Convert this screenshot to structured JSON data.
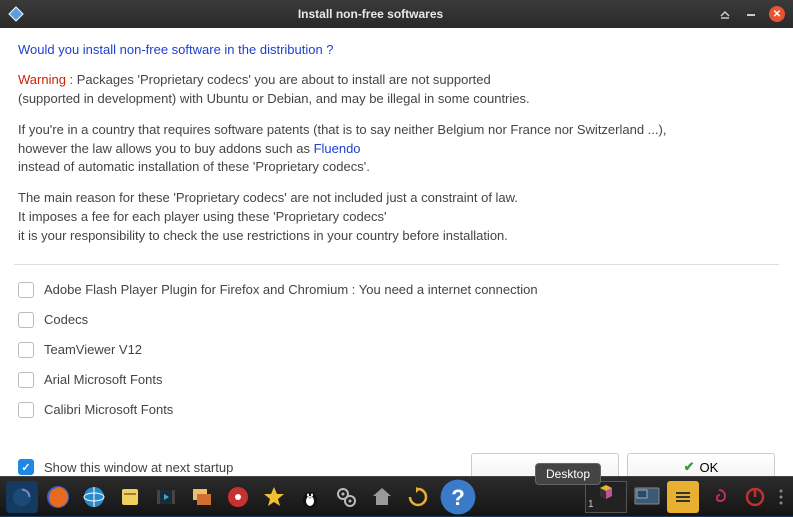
{
  "titlebar": {
    "title": "Install non-free softwares"
  },
  "content": {
    "question": "Would you install non-free software in the distribution ?",
    "warning_label": "Warning : ",
    "warning_line1": "Packages 'Proprietary codecs' you are about to install are not supported",
    "warning_line2": "(supported in development) with Ubuntu or Debian, and may be illegal in some countries.",
    "patents_line1a": "If you're in a country that requires software patents (that is to say neither Belgium nor France nor Switzerland ...),",
    "patents_line2a": "however the law allows you to buy addons such as ",
    "fluendo_link": "Fluendo",
    "patents_line3": "instead of automatic installation of these 'Proprietary codecs'.",
    "reason_line1": "The main reason for these 'Proprietary codecs' are not included just a constraint of law.",
    "reason_line2": "It imposes a fee for each player using these 'Proprietary codecs'",
    "reason_line3": "it is your responsibility to check the use restrictions in your country before installation."
  },
  "items": [
    {
      "label": "Adobe Flash Player Plugin for Firefox and Chromium : You need a internet connection",
      "checked": false
    },
    {
      "label": "Codecs",
      "checked": false
    },
    {
      "label": "TeamViewer V12",
      "checked": false
    },
    {
      "label": "Arial Microsoft Fonts",
      "checked": false
    },
    {
      "label": "Calibri Microsoft Fonts",
      "checked": false
    }
  ],
  "footer": {
    "show_at_startup_label": "Show this window at next startup",
    "show_at_startup_checked": true,
    "cancel_label": "",
    "ok_label": "OK"
  },
  "tooltip": "Desktop",
  "workspace_number": "1"
}
